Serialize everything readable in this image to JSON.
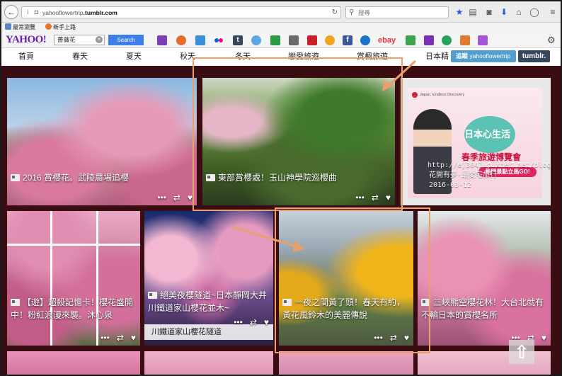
{
  "browser": {
    "url_host": "yahooflowertrip",
    "url_domain": ".tumblr.com",
    "search_placeholder": "搜尋",
    "bookmarks": [
      "最常瀏覽",
      "新手上路"
    ]
  },
  "yahoo_toolbar": {
    "logo": "YAHOO!",
    "query": "薔薇花",
    "search_label": "Search",
    "clear_glyph": "×",
    "ebay_label": "ebay"
  },
  "blog": {
    "menu": [
      "首頁",
      "春天",
      "夏天",
      "秋天",
      "冬天",
      "戀愛旅遊",
      "賞楓旅遊",
      "日本精"
    ],
    "follow_label": "追蹤",
    "follow_name": "yahooflowertrip",
    "tumblr_label": "tumblr."
  },
  "posts": [
    {
      "title": "2016 賞櫻花。武陵農場追櫻"
    },
    {
      "title": "東部賞櫻處！玉山神學院巡櫻曲"
    },
    {
      "ad_brand": "Japan. Endless Discovery",
      "ad_title": "日本心生活",
      "ad_subtitle": "春季旅遊博覽會",
      "ad_cta": "熱門景點立馬GO!"
    },
    {
      "title": "【遊】超殺記憶卡！櫻花盛開中！粉紅浪漫來襲。沐心泉"
    },
    {
      "title": "絕美夜櫻隧道~日本靜岡大井川鐵道家山櫻花並木~",
      "image_text": "川鐵道家山櫻花隧道"
    },
    {
      "title": "一夜之間黃了頭！春天有約，黃花風鈴木的美麗傳說"
    },
    {
      "title": "三峽熊空櫻花林！大台北就有不輸日本的賞櫻名所"
    }
  ],
  "watermarks": [
    "http://ej3041.pixnet.net/blog",
    "花開有夢-最愛宅旅行",
    "2016-03-12"
  ],
  "actions": {
    "more": "•••",
    "reblog": "⇄",
    "like": "♥"
  },
  "back_to_top": "⇧",
  "colors": {
    "page_bg": "#3a0d12",
    "highlight": "#e9a06a",
    "follow": "#529ecc",
    "tumblr": "#36465d",
    "yahoo": "#6b1fb1",
    "search_button": "#3d7ee8"
  }
}
